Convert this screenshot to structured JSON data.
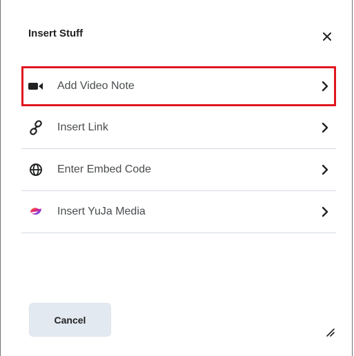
{
  "dialog": {
    "title": "Insert Stuff",
    "close_icon": "close-icon",
    "items": [
      {
        "label": "Add Video Note",
        "icon": "video-camera-icon",
        "highlighted": true
      },
      {
        "label": "Insert Link",
        "icon": "link-icon"
      },
      {
        "label": "Enter Embed Code",
        "icon": "globe-icon"
      },
      {
        "label": "Insert YuJa Media",
        "icon": "yuja-logo-icon"
      }
    ],
    "cancel_label": "Cancel"
  },
  "colors": {
    "highlight_border": "#e0151e",
    "text": "#494c4e",
    "button_bg": "#e3e9f1",
    "divider": "#d3d9e3"
  }
}
